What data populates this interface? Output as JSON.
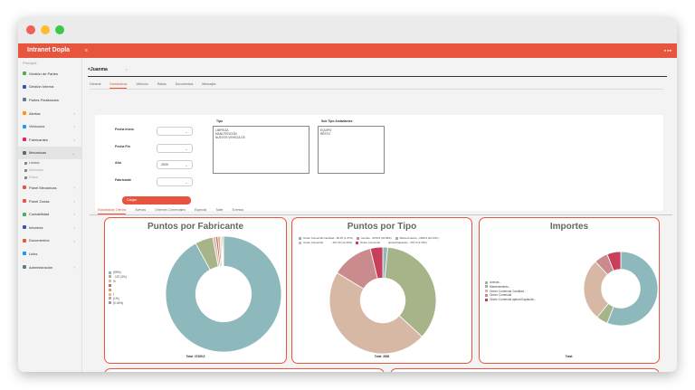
{
  "app": {
    "brand": "Intranet Dopla",
    "menu_icon": "≡",
    "top_right": "● ●●"
  },
  "sidebar": {
    "header": "Principal",
    "items": [
      {
        "label": "Gestión de Partes",
        "icon": "clipboard-icon",
        "color": "#4caf50",
        "chevron": ""
      },
      {
        "label": "Gestión Interna",
        "icon": "briefcase-icon",
        "color": "#3f51b5",
        "chevron": ""
      },
      {
        "label": "Partes Finalizados",
        "icon": "check-list-icon",
        "color": "#607d8b",
        "chevron": ""
      },
      {
        "label": "Alertas",
        "icon": "bell-icon",
        "color": "#ff9800",
        "chevron": "›"
      },
      {
        "label": "Vehículos",
        "icon": "car-icon",
        "color": "#2196f3",
        "chevron": "›"
      },
      {
        "label": "Fabricantes",
        "icon": "factory-icon",
        "color": "#e91e63",
        "chevron": "›"
      },
      {
        "label": "Mecanicas",
        "icon": "wrench-icon",
        "color": "#546e7a",
        "chevron": "⌄"
      }
    ],
    "subitems": [
      "Listado",
      "Alineadas",
      "Ratios"
    ],
    "items2": [
      {
        "label": "Panel Mecanicas",
        "icon": "chart-icon",
        "color": "#e8553f",
        "chevron": "›"
      },
      {
        "label": "Panel Zonas",
        "icon": "map-icon",
        "color": "#e8553f",
        "chevron": "›"
      },
      {
        "label": "Contabilidad",
        "icon": "calculator-icon",
        "color": "#4caf50",
        "chevron": "›"
      },
      {
        "label": "Informes",
        "icon": "report-icon",
        "color": "#3f51b5",
        "chevron": "›"
      },
      {
        "label": "Documentos",
        "icon": "folder-icon",
        "color": "#e8553f",
        "chevron": "›"
      },
      {
        "label": "Links",
        "icon": "link-icon",
        "color": "#2196f3",
        "chevron": ""
      },
      {
        "label": "Administración",
        "icon": "settings-icon",
        "color": "#607d8b",
        "chevron": "›"
      }
    ]
  },
  "header": {
    "selected": "<Juanma",
    "chevron": "›"
  },
  "tabs": [
    "General",
    "Estadísticas",
    "Vehículo",
    "Ratios",
    "Documentos",
    "Mensajes"
  ],
  "filters": {
    "fecha_inicio": "Fecha Inicio",
    "fecha_fin": "Fecha Fin",
    "anio": "Año",
    "anio_value": "2020",
    "fabricante": "Fabricante",
    "tipo_header": "Tipo",
    "tipo_options": [
      "LIMPIEZA",
      "MANUTENCIÓN",
      "NUEVOS VEHÍCULOS"
    ],
    "subtipo_header": "Sub Tipo Amiadantes",
    "subtipo_options": [
      "EQUIPO",
      "RESTO"
    ],
    "button": "Cargar"
  },
  "subtabs": [
    "Estadísticas Ofertas",
    "Averías",
    "Ordenes Comerciales",
    "Especial",
    "Taller",
    "Eventos"
  ],
  "charts": {
    "fabricante": {
      "title": "Puntos por Fabricante",
      "legend": [
        "(99%)",
        "- 157 (3%)",
        "%",
        "",
        "",
        ")",
        "(1%)",
        "(0.04%)"
      ],
      "total": "Total: 37385,5"
    },
    "tipo": {
      "title": "Puntos por Tipo",
      "legend_row1": [
        "Orden Comercial Cantidad - 96.25 (1.47%)",
        "Averías - 3278.0 (34.99%)",
        "Mantenimiento - 1696.9 (46.21%)"
      ],
      "legend_row2": [
        "Orden Comercial",
        "- 407.20 (12.43%)",
        "Orden Comercial",
        "aptura/Captación - 257.5 (3.73%)"
      ],
      "total": "Total: 3838"
    },
    "importes": {
      "title": "Importes",
      "legend": [
        "Averías -",
        "Mantenimiento -",
        "Orden Comercial Cantidad -",
        "Orden Comercial",
        "Orden Comercial                aptura/Captación -"
      ],
      "total": "Total:"
    }
  },
  "chart_data": [
    {
      "type": "pie",
      "title": "Puntos por Fabricante",
      "categories": [
        "A",
        "B",
        "C",
        "D",
        "E",
        "F",
        "G",
        "H"
      ],
      "values": [
        92.0,
        5.0,
        0.8,
        0.6,
        0.6,
        0.4,
        0.3,
        0.3
      ],
      "colors": [
        "#8db9bd",
        "#a7b48a",
        "#d7b8a5",
        "#c46b6f",
        "#d0a070",
        "#e0c060",
        "#b5a5c8",
        "#9a9a9a"
      ]
    },
    {
      "type": "pie",
      "title": "Puntos por Tipo",
      "categories": [
        "Orden Comercial Cantidad",
        "Mantenimiento",
        "Orden Comercial",
        "Averías",
        "Captación"
      ],
      "values": [
        1.47,
        34.99,
        46.21,
        12.43,
        3.73
      ],
      "colors": [
        "#8db9bd",
        "#a7b48a",
        "#d7b8a5",
        "#c98b8d",
        "#c73f5a"
      ]
    },
    {
      "type": "pie",
      "title": "Importes",
      "categories": [
        "Averías",
        "Mantenimiento",
        "Orden Comercial Cantidad",
        "Orden Comercial",
        "Captación"
      ],
      "values": [
        56,
        5,
        27,
        6,
        6
      ],
      "colors": [
        "#8db9bd",
        "#a7b48a",
        "#d7b8a5",
        "#c98b8d",
        "#c73f5a"
      ]
    }
  ]
}
